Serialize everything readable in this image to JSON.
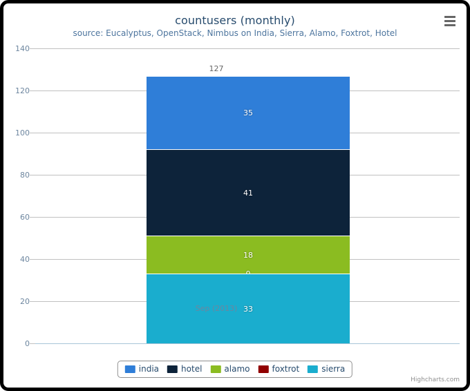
{
  "chart_data": {
    "type": "bar",
    "stacked": true,
    "title": "countusers (monthly)",
    "subtitle": "source: Eucalyptus, OpenStack, Nimbus on India, Sierra, Alamo, Foxtrot, Hotel",
    "xlabel": "",
    "ylabel": "",
    "categories": [
      "Sep (2013)"
    ],
    "ylim": [
      0,
      140
    ],
    "ytick_step": 20,
    "ytick_labels": [
      "0",
      "20",
      "40",
      "60",
      "80",
      "100",
      "120",
      "140"
    ],
    "grid": true,
    "legend_position": "bottom",
    "stack_totals": [
      127
    ],
    "series": [
      {
        "name": "india",
        "values": [
          35
        ],
        "color": "#2f7ed8",
        "stack_order": 5
      },
      {
        "name": "hotel",
        "values": [
          41
        ],
        "color": "#0d233a",
        "stack_order": 4
      },
      {
        "name": "alamo",
        "values": [
          18
        ],
        "color": "#8bbc21",
        "stack_order": 3
      },
      {
        "name": "foxtrot",
        "values": [
          0
        ],
        "color": "#910000",
        "stack_order": 2
      },
      {
        "name": "sierra",
        "values": [
          33
        ],
        "color": "#1aadce",
        "stack_order": 1
      }
    ]
  },
  "header": {
    "title": "countusers (monthly)",
    "subtitle": "source: Eucalyptus, OpenStack, Nimbus on India, Sierra, Alamo, Foxtrot, Hotel",
    "export_icon": "hamburger-menu-icon"
  },
  "yaxis": {
    "ticks": [
      "140",
      "120",
      "100",
      "80",
      "60",
      "40",
      "20",
      "0"
    ]
  },
  "xaxis": {
    "categories": [
      "Sep (2013)"
    ]
  },
  "stack": {
    "total_label": "127",
    "segments": [
      {
        "label": "35",
        "series": "india",
        "color": "#2f7ed8",
        "value": 35
      },
      {
        "label": "41",
        "series": "hotel",
        "color": "#0d233a",
        "value": 41
      },
      {
        "label": "18",
        "series": "alamo",
        "color": "#8bbc21",
        "value": 18
      },
      {
        "label": "0",
        "series": "foxtrot",
        "color": "#910000",
        "value": 0
      },
      {
        "label": "33",
        "series": "sierra",
        "color": "#1aadce",
        "value": 33
      }
    ]
  },
  "legend": {
    "items": [
      {
        "label": "india",
        "color": "#2f7ed8"
      },
      {
        "label": "hotel",
        "color": "#0d233a"
      },
      {
        "label": "alamo",
        "color": "#8bbc21"
      },
      {
        "label": "foxtrot",
        "color": "#910000"
      },
      {
        "label": "sierra",
        "color": "#1aadce"
      }
    ]
  },
  "credits": {
    "text": "Highcharts.com"
  }
}
